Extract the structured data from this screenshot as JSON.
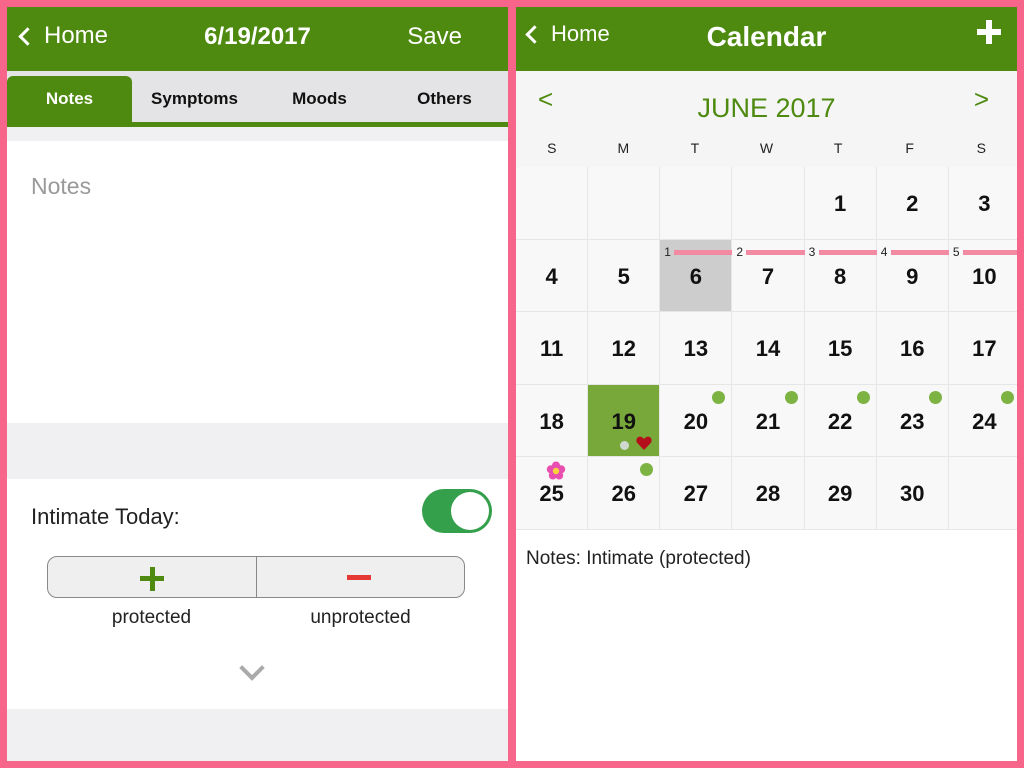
{
  "left": {
    "header": {
      "back_label": "Home",
      "title": "6/19/2017",
      "save_label": "Save"
    },
    "tabs": [
      {
        "label": "Notes",
        "active": true
      },
      {
        "label": "Symptoms",
        "active": false
      },
      {
        "label": "Moods",
        "active": false
      },
      {
        "label": "Others",
        "active": false
      }
    ],
    "notes": {
      "placeholder": "Notes",
      "value": ""
    },
    "intimate": {
      "label": "Intimate Today:",
      "toggle_on": true,
      "protected_label": "protected",
      "unprotected_label": "unprotected"
    }
  },
  "right": {
    "header": {
      "back_label": "Home",
      "title": "Calendar"
    },
    "month": {
      "prev": "<",
      "title": "JUNE 2017",
      "next": ">"
    },
    "weekdays": [
      "S",
      "M",
      "T",
      "W",
      "T",
      "F",
      "S"
    ],
    "weeks": [
      [
        {
          "num": ""
        },
        {
          "num": ""
        },
        {
          "num": ""
        },
        {
          "num": ""
        },
        {
          "num": "1"
        },
        {
          "num": "2"
        },
        {
          "num": "3"
        }
      ],
      [
        {
          "num": "4"
        },
        {
          "num": "5"
        },
        {
          "num": "6",
          "gray": true,
          "period_day": "1"
        },
        {
          "num": "7",
          "period_day": "2"
        },
        {
          "num": "8",
          "period_day": "3"
        },
        {
          "num": "9",
          "period_day": "4"
        },
        {
          "num": "10",
          "period_day": "5"
        }
      ],
      [
        {
          "num": "11"
        },
        {
          "num": "12"
        },
        {
          "num": "13"
        },
        {
          "num": "14"
        },
        {
          "num": "15"
        },
        {
          "num": "16"
        },
        {
          "num": "17"
        }
      ],
      [
        {
          "num": "18"
        },
        {
          "num": "19",
          "today": true,
          "note_dot": true,
          "heart": true
        },
        {
          "num": "20",
          "dot": true
        },
        {
          "num": "21",
          "dot": true
        },
        {
          "num": "22",
          "dot": true
        },
        {
          "num": "23",
          "dot": true
        },
        {
          "num": "24",
          "dot": true
        }
      ],
      [
        {
          "num": "25",
          "flower": true
        },
        {
          "num": "26",
          "dot": true
        },
        {
          "num": "27"
        },
        {
          "num": "28"
        },
        {
          "num": "29"
        },
        {
          "num": "30"
        },
        {
          "num": ""
        }
      ]
    ],
    "notes_text": "Notes: Intimate (protected)"
  },
  "colors": {
    "header_green": "#4e8a10",
    "today_green": "#79a83a",
    "fertile_dot": "#7cb342",
    "period_bar": "#f38aa4",
    "frame_pink": "#f7658b",
    "toggle_on": "#34a04c",
    "minus_red": "#e53935"
  },
  "icons": [
    "chevron-left-icon",
    "plus-icon",
    "minus-icon",
    "chevron-down-icon",
    "heart-icon",
    "flower-icon",
    "add-icon"
  ]
}
